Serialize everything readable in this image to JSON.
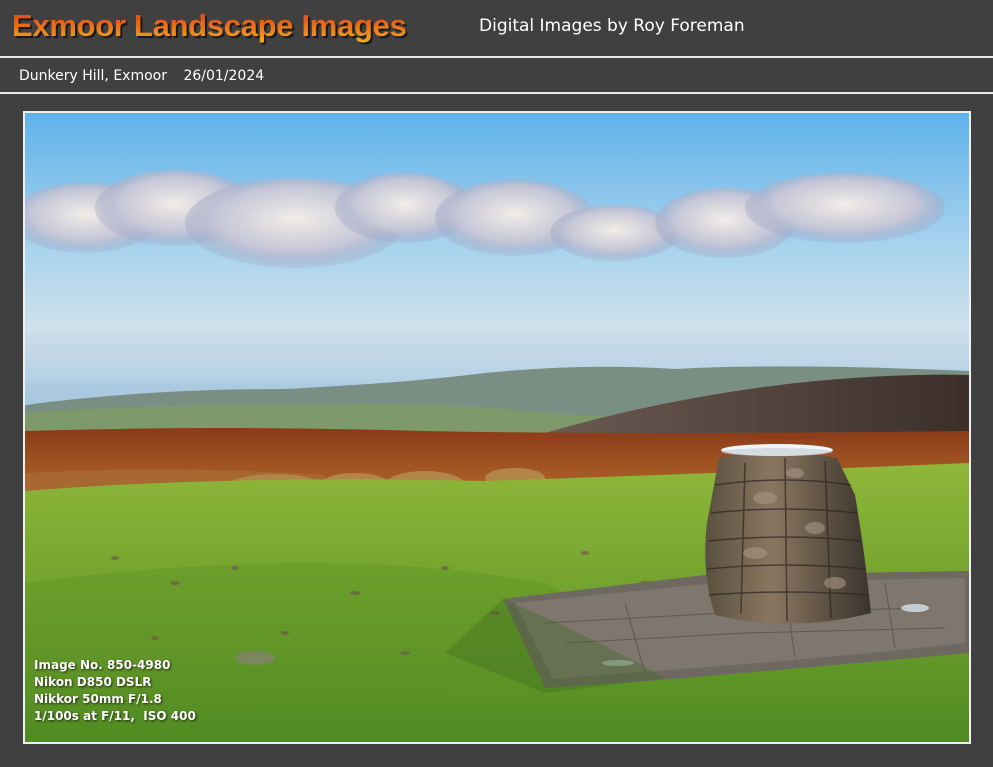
{
  "header": {
    "title": "Exmoor Landscape Images",
    "subtitle": "Digital Images by Roy Foreman"
  },
  "caption": {
    "location": "Dunkery Hill, Exmoor",
    "date": "26/01/2024"
  },
  "photo": {
    "alt": "Dunkery Hill, Exmoor"
  },
  "exif": {
    "image_no": "Image No. 850-4980",
    "camera": "Nikon D850 DSLR",
    "lens": "Nikkor 50mm F/1.8",
    "exposure": "1/100s at F/11,  ISO 400"
  },
  "colors": {
    "background": "#404040",
    "title_top": "#e23a10",
    "title_bottom": "#f2b21e",
    "divider": "#e8e8e8"
  }
}
